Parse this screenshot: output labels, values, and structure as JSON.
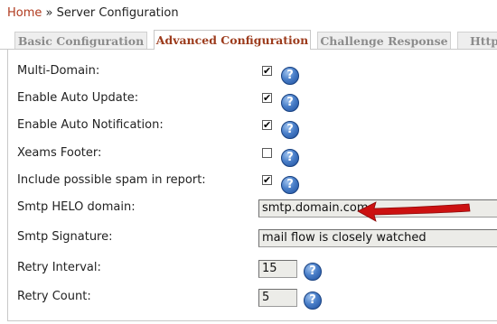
{
  "breadcrumb": {
    "home": "Home",
    "separator": "»",
    "current": "Server Configuration"
  },
  "tabs": [
    {
      "label": "Basic Configuration",
      "active": false
    },
    {
      "label": "Advanced Configuration",
      "active": true
    },
    {
      "label": "Challenge Response",
      "active": false
    },
    {
      "label": "Http",
      "active": false
    }
  ],
  "settings": {
    "multi_domain": {
      "label": "Multi-Domain:",
      "checked": true
    },
    "auto_update": {
      "label": "Enable Auto Update:",
      "checked": true
    },
    "auto_notification": {
      "label": "Enable Auto Notification:",
      "checked": true
    },
    "xeams_footer": {
      "label": "Xeams Footer:",
      "checked": false
    },
    "spam_report": {
      "label": "Include possible spam in report:",
      "checked": true
    },
    "smtp_helo": {
      "label": "Smtp HELO domain:",
      "value": "smtp.domain.com"
    },
    "smtp_signature": {
      "label": "Smtp Signature:",
      "value": "mail flow is closely watched"
    },
    "retry_interval": {
      "label": "Retry Interval:",
      "value": "15"
    },
    "retry_count": {
      "label": "Retry Count:",
      "value": "5"
    }
  },
  "help_glyph": "?",
  "check_glyph": "✔",
  "colors": {
    "link": "#b03a1e",
    "active_tab": "#9c3b1c",
    "arrow": "#cc1111",
    "help": "#2f63b0"
  }
}
